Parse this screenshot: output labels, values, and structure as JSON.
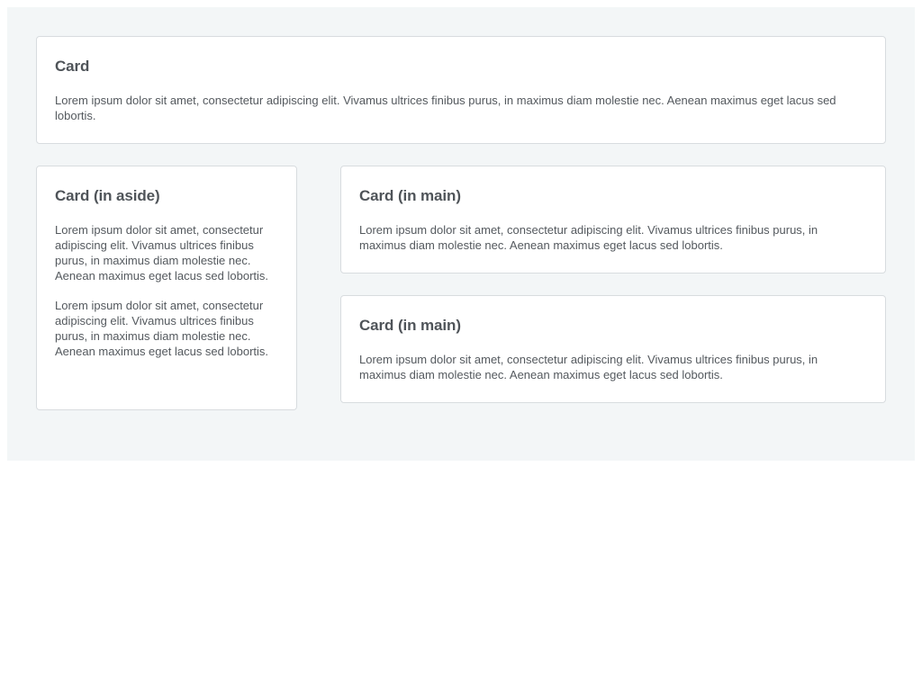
{
  "cards": {
    "top": {
      "title": "Card",
      "paragraphs": [
        "Lorem ipsum dolor sit amet, consectetur adipiscing elit. Vivamus ultrices finibus purus, in maximus diam molestie nec. Aenean maximus eget lacus sed lobortis."
      ]
    },
    "aside": {
      "title": "Card (in aside)",
      "paragraphs": [
        "Lorem ipsum dolor sit amet, consectetur adipiscing elit. Vivamus ultrices finibus purus, in maximus diam molestie nec. Aenean maximus eget lacus sed lobortis.",
        "Lorem ipsum dolor sit amet, consectetur adipiscing elit. Vivamus ultrices finibus purus, in maximus diam molestie nec. Aenean maximus eget lacus sed lobortis."
      ]
    },
    "main": [
      {
        "title": "Card (in main)",
        "paragraphs": [
          "Lorem ipsum dolor sit amet, consectetur adipiscing elit. Vivamus ultrices finibus purus, in maximus diam molestie nec. Aenean maximus eget lacus sed lobortis."
        ]
      },
      {
        "title": "Card (in main)",
        "paragraphs": [
          "Lorem ipsum dolor sit amet, consectetur adipiscing elit. Vivamus ultrices finibus purus, in maximus diam molestie nec. Aenean maximus eget lacus sed lobortis."
        ]
      }
    ]
  },
  "colors": {
    "page_background": "#f3f6f7",
    "card_background": "#ffffff",
    "card_border": "#d8dcdf",
    "heading_text": "#4f5459",
    "body_text": "#54595e"
  }
}
